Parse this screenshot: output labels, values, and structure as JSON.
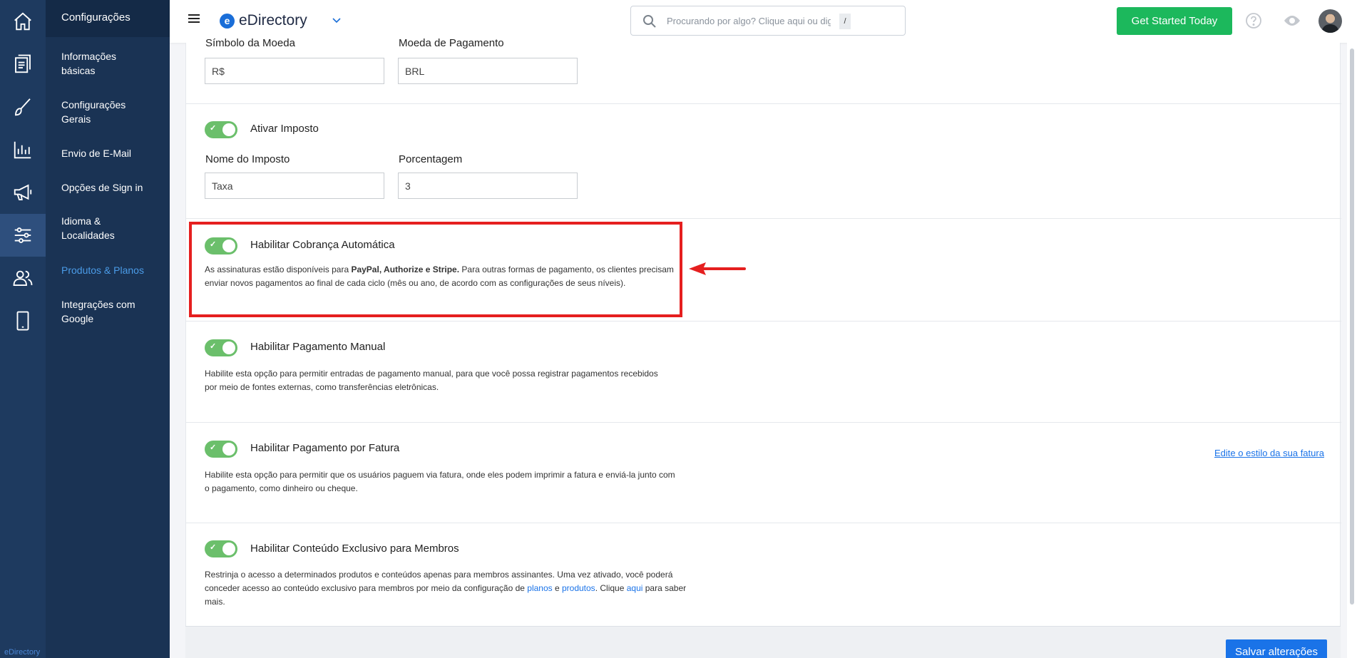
{
  "sidebar": {
    "title": "Configurações",
    "items": [
      {
        "label": "Informações básicas"
      },
      {
        "label": "Configurações Gerais"
      },
      {
        "label": "Envio de E-Mail"
      },
      {
        "label": "Opções de Sign in"
      },
      {
        "label": "Idioma & Localidades"
      },
      {
        "label": "Produtos & Planos",
        "active": true
      },
      {
        "label": "Integrações com Google"
      }
    ],
    "brand": "eDirectory"
  },
  "rail": {
    "icons": [
      "home-icon",
      "pages-icon",
      "brush-icon",
      "reports-icon",
      "megaphone-icon",
      "sliders-icon",
      "users-icon",
      "mobile-icon"
    ],
    "active": "sliders-icon"
  },
  "header": {
    "logo_letter": "e",
    "logo_text": "eDirectory",
    "search_placeholder": "Procurando por algo? Clique aqui ou digite",
    "search_key": "/",
    "cta_label": "Get Started Today"
  },
  "currency": {
    "symbol_label": "Símbolo da Moeda",
    "symbol_value": "R$",
    "payment_label": "Moeda de Pagamento",
    "payment_value": "BRL"
  },
  "tax": {
    "toggle_label": "Ativar Imposto",
    "name_label": "Nome do Imposto",
    "name_value": "Taxa",
    "percent_label": "Porcentagem",
    "percent_value": "3"
  },
  "auto_billing": {
    "toggle_label": "Habilitar Cobrança Automática",
    "desc_pre": "As assinaturas estão disponíveis para ",
    "desc_bold": "PayPal, Authorize e Stripe.",
    "desc_post": " Para outras formas de pagamento, os clientes precisam enviar novos pagamentos ao final de cada ciclo (mês ou ano, de acordo com as configurações de seus níveis)."
  },
  "manual_payment": {
    "toggle_label": "Habilitar Pagamento Manual",
    "desc": "Habilite esta opção para permitir entradas de pagamento manual, para que você possa registrar pagamentos recebidos por meio de fontes externas, como transferências eletrônicas."
  },
  "invoice_payment": {
    "toggle_label": "Habilitar Pagamento por Fatura",
    "desc": "Habilite esta opção para permitir que os usuários paguem via fatura, onde eles podem imprimir a fatura e enviá-la junto com o pagamento, como dinheiro ou cheque.",
    "edit_link": "Edite o estilo da sua fatura"
  },
  "members_content": {
    "toggle_label": "Habilitar Conteúdo Exclusivo para Membros",
    "desc_pre": "Restrinja o acesso a determinados produtos e conteúdos apenas para membros assinantes. Uma vez ativado, você poderá conceder acesso ao conteúdo exclusivo para membros por meio da configuração de ",
    "link_plans": "planos",
    "and_text": " e ",
    "link_products": "produtos",
    "desc_mid": ". Clique ",
    "link_here": "aqui",
    "desc_post": " para saber mais."
  },
  "footer": {
    "save_label": "Salvar alterações"
  },
  "colors": {
    "rail_bg": "#1e3a5f",
    "subnav_bg": "#1a3354",
    "accent": "#1a73e8",
    "toggle_on": "#6bbf6b",
    "cta_green": "#1cb85c",
    "highlight": "#e51f1f"
  }
}
